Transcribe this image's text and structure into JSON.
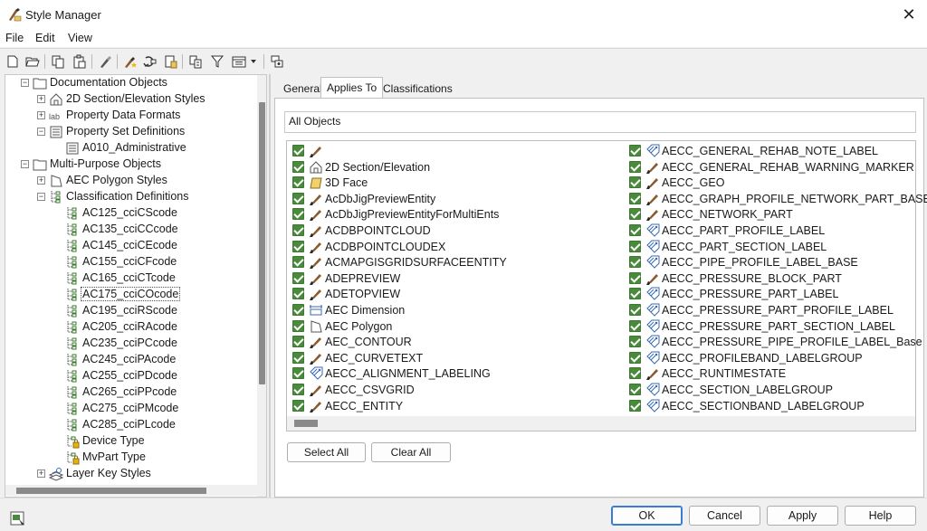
{
  "window": {
    "title": "Style Manager",
    "close_glyph": "✕"
  },
  "menu": [
    "File",
    "Edit",
    "View"
  ],
  "tree": [
    {
      "label": "Documentation Objects",
      "level": 0,
      "expander": "−",
      "icon": "folder-icon"
    },
    {
      "label": "2D Section/Elevation Styles",
      "level": 1,
      "expander": "+",
      "icon": "house-icon"
    },
    {
      "label": "Property Data Formats",
      "level": 1,
      "expander": "+",
      "icon": "lab-icon"
    },
    {
      "label": "Property Set Definitions",
      "level": 1,
      "expander": "−",
      "icon": "table-icon"
    },
    {
      "label": "A010_Administrative",
      "level": 2,
      "expander": "",
      "icon": "table-icon"
    },
    {
      "label": "Multi-Purpose Objects",
      "level": 0,
      "expander": "−",
      "icon": "folder-icon"
    },
    {
      "label": "AEC Polygon Styles",
      "level": 1,
      "expander": "+",
      "icon": "polygon-icon"
    },
    {
      "label": "Classification Definitions",
      "level": 1,
      "expander": "−",
      "icon": "classification-icon"
    },
    {
      "label": "AC125_cciCScode",
      "level": 2,
      "expander": "",
      "icon": "classification-icon"
    },
    {
      "label": "AC135_cciCCcode",
      "level": 2,
      "expander": "",
      "icon": "classification-icon"
    },
    {
      "label": "AC145_cciCEcode",
      "level": 2,
      "expander": "",
      "icon": "classification-icon"
    },
    {
      "label": "AC155_cciCFcode",
      "level": 2,
      "expander": "",
      "icon": "classification-icon"
    },
    {
      "label": "AC165_cciCTcode",
      "level": 2,
      "expander": "",
      "icon": "classification-icon"
    },
    {
      "label": "AC175_cciCOcode",
      "level": 2,
      "expander": "",
      "icon": "classification-icon",
      "selected": true
    },
    {
      "label": "AC195_cciRScode",
      "level": 2,
      "expander": "",
      "icon": "classification-icon"
    },
    {
      "label": "AC205_cciRAcode",
      "level": 2,
      "expander": "",
      "icon": "classification-icon"
    },
    {
      "label": "AC235_cciPCcode",
      "level": 2,
      "expander": "",
      "icon": "classification-icon"
    },
    {
      "label": "AC245_cciPAcode",
      "level": 2,
      "expander": "",
      "icon": "classification-icon"
    },
    {
      "label": "AC255_cciPDcode",
      "level": 2,
      "expander": "",
      "icon": "classification-icon"
    },
    {
      "label": "AC265_cciPPcode",
      "level": 2,
      "expander": "",
      "icon": "classification-icon"
    },
    {
      "label": "AC275_cciPMcode",
      "level": 2,
      "expander": "",
      "icon": "classification-icon"
    },
    {
      "label": "AC285_cciPLcode",
      "level": 2,
      "expander": "",
      "icon": "classification-icon"
    },
    {
      "label": "Device Type",
      "level": 2,
      "expander": "",
      "icon": "locked-classification-icon"
    },
    {
      "label": "MvPart Type",
      "level": 2,
      "expander": "",
      "icon": "locked-classification-icon"
    },
    {
      "label": "Layer Key Styles",
      "level": 1,
      "expander": "+",
      "icon": "layer-key-icon"
    }
  ],
  "tabs": [
    "General",
    "Applies To",
    "Classifications"
  ],
  "active_tab": "Applies To",
  "all_objects_label": "All Objects",
  "list_col1": [
    {
      "label": "",
      "icon": "brush-icon"
    },
    {
      "label": "2D Section/Elevation",
      "icon": "house-icon"
    },
    {
      "label": "3D Face",
      "icon": "face-icon"
    },
    {
      "label": "AcDbJigPreviewEntity",
      "icon": "brush-icon"
    },
    {
      "label": "AcDbJigPreviewEntityForMultiEnts",
      "icon": "brush-icon"
    },
    {
      "label": "ACDBPOINTCLOUD",
      "icon": "brush-icon"
    },
    {
      "label": "ACDBPOINTCLOUDEX",
      "icon": "brush-icon"
    },
    {
      "label": "ACMAPGISGRIDSURFACEENTITY",
      "icon": "brush-icon"
    },
    {
      "label": "ADEPREVIEW",
      "icon": "brush-icon"
    },
    {
      "label": "ADETOPVIEW",
      "icon": "brush-icon"
    },
    {
      "label": "AEC Dimension",
      "icon": "dimension-icon"
    },
    {
      "label": "AEC Polygon",
      "icon": "polygon-icon"
    },
    {
      "label": "AEC_CONTOUR",
      "icon": "brush-icon"
    },
    {
      "label": "AEC_CURVETEXT",
      "icon": "brush-icon"
    },
    {
      "label": "AECC_ALIGNMENT_LABELING",
      "icon": "tag-icon"
    },
    {
      "label": "AECC_CSVGRID",
      "icon": "brush-icon"
    },
    {
      "label": "AECC_ENTITY",
      "icon": "brush-icon"
    }
  ],
  "list_col2": [
    {
      "label": "AECC_GENERAL_REHAB_NOTE_LABEL",
      "icon": "tag-icon"
    },
    {
      "label": "AECC_GENERAL_REHAB_WARNING_MARKER",
      "icon": "brush-icon"
    },
    {
      "label": "AECC_GEO",
      "icon": "brush-icon"
    },
    {
      "label": "AECC_GRAPH_PROFILE_NETWORK_PART_BASE",
      "icon": "brush-icon"
    },
    {
      "label": "AECC_NETWORK_PART",
      "icon": "brush-icon"
    },
    {
      "label": "AECC_PART_PROFILE_LABEL",
      "icon": "tag-icon"
    },
    {
      "label": "AECC_PART_SECTION_LABEL",
      "icon": "tag-icon"
    },
    {
      "label": "AECC_PIPE_PROFILE_LABEL_BASE",
      "icon": "tag-icon"
    },
    {
      "label": "AECC_PRESSURE_BLOCK_PART",
      "icon": "brush-icon"
    },
    {
      "label": "AECC_PRESSURE_PART_LABEL",
      "icon": "tag-icon"
    },
    {
      "label": "AECC_PRESSURE_PART_PROFILE_LABEL",
      "icon": "tag-icon"
    },
    {
      "label": "AECC_PRESSURE_PART_SECTION_LABEL",
      "icon": "tag-icon"
    },
    {
      "label": "AECC_PRESSURE_PIPE_PROFILE_LABEL_Base",
      "icon": "tag-icon"
    },
    {
      "label": "AECC_PROFILEBAND_LABELGROUP",
      "icon": "tag-icon"
    },
    {
      "label": "AECC_RUNTIMESTATE",
      "icon": "brush-icon"
    },
    {
      "label": "AECC_SECTION_LABELGROUP",
      "icon": "tag-icon"
    },
    {
      "label": "AECC_SECTIONBAND_LABELGROUP",
      "icon": "tag-icon"
    }
  ],
  "buttons": {
    "select_all": "Select All",
    "clear_all": "Clear All",
    "ok": "OK",
    "cancel": "Cancel",
    "apply": "Apply",
    "help": "Help"
  },
  "colors": {
    "checkbox": "#4a8a3c",
    "brush_handle": "#8b5a2b",
    "brush_tip": "#2a2a2a",
    "accent": "#3a7bd5"
  }
}
